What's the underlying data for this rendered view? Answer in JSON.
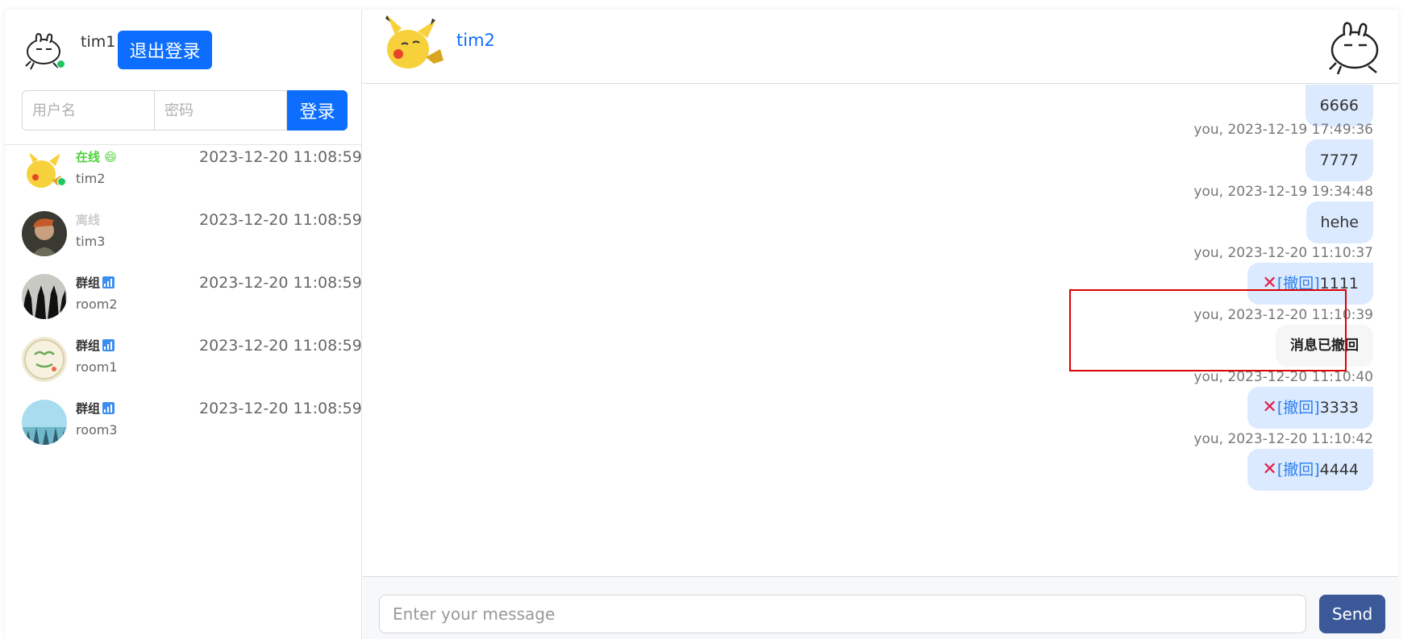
{
  "me": {
    "name": "tim1",
    "logout_label": "退出登录"
  },
  "login": {
    "user_placeholder": "用户名",
    "pass_placeholder": "密码",
    "button_label": "登录"
  },
  "contacts": [
    {
      "status": "在线 😄",
      "status_color": "#4cd137",
      "name": "tim2",
      "time": "2023-12-20 11:08:59",
      "online": true
    },
    {
      "status": "离线",
      "status_color": "#cccccc",
      "name": "tim3",
      "time": "2023-12-20 11:08:59",
      "online": false
    },
    {
      "status": "群组",
      "status_color": "#333333",
      "name": "room2",
      "time": "2023-12-20 11:08:59",
      "group": true
    },
    {
      "status": "群组",
      "status_color": "#333333",
      "name": "room1",
      "time": "2023-12-20 11:08:59",
      "group": true
    },
    {
      "status": "群组",
      "status_color": "#333333",
      "name": "room3",
      "time": "2023-12-20 11:08:59",
      "group": true
    }
  ],
  "chat": {
    "peer_name": "tim2",
    "messages": [
      {
        "text": "6666"
      },
      {
        "meta": "you, 2023-12-19 17:49:36",
        "text": "7777"
      },
      {
        "meta": "you, 2023-12-19 19:34:48",
        "text": "hehe"
      },
      {
        "meta": "you, 2023-12-20 11:10:37",
        "recall": "[撤回]",
        "text": "1111"
      },
      {
        "meta": "you, 2023-12-20 11:10:39",
        "recalled_text": "消息已撤回"
      },
      {
        "meta": "you, 2023-12-20 11:10:40",
        "recall": "[撤回]",
        "text": "3333"
      },
      {
        "meta": "you, 2023-12-20 11:10:42",
        "recall": "[撤回]",
        "text": "4444"
      }
    ],
    "input_placeholder": "Enter your message",
    "send_label": "Send"
  },
  "icons": {
    "delete": "x-icon",
    "group": "signal-icon",
    "online": "online-dot-icon"
  }
}
